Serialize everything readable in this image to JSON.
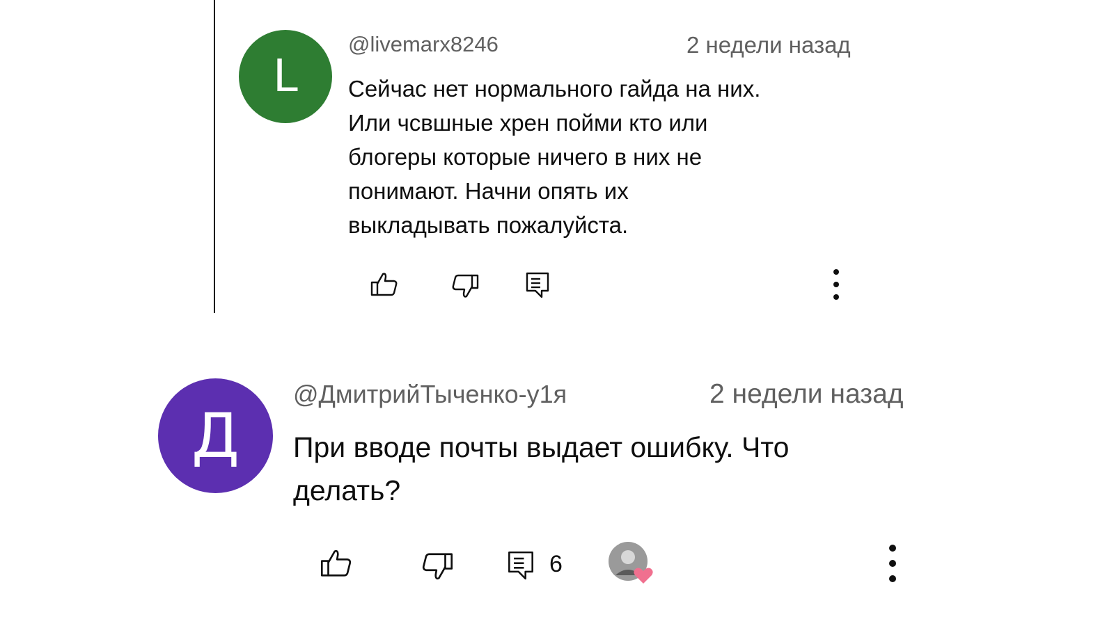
{
  "colors": {
    "avatar1": "#2e7d32",
    "avatar2": "#5c2fb0",
    "heart": "#f0708f",
    "text": "#0f0f0f",
    "meta": "#606060"
  },
  "comments": [
    {
      "avatar_letter": "L",
      "handle": "@livemarx8246",
      "time": "2 недели назад",
      "lines": [
        "Сейчас нет нормального гайда на них.",
        "Или чсвшные хрен пойми кто или",
        "блогеры которые ничего в них не",
        "понимают.  Начни опять их",
        "выкладывать пожалуйста."
      ],
      "icons": [
        "thumbs-up-icon",
        "thumbs-down-icon",
        "reply-icon",
        "more-vert-icon"
      ]
    },
    {
      "avatar_letter": "Д",
      "handle": "@ДмитрийТыченко-у1я",
      "time": "2 недели назад",
      "lines": [
        "При вводе почты выдает ошибку. Что",
        "делать?"
      ],
      "reply_count": "6",
      "icons": [
        "thumbs-up-icon",
        "thumbs-down-icon",
        "reply-icon",
        "creator-heart-icon",
        "more-vert-icon"
      ]
    }
  ]
}
